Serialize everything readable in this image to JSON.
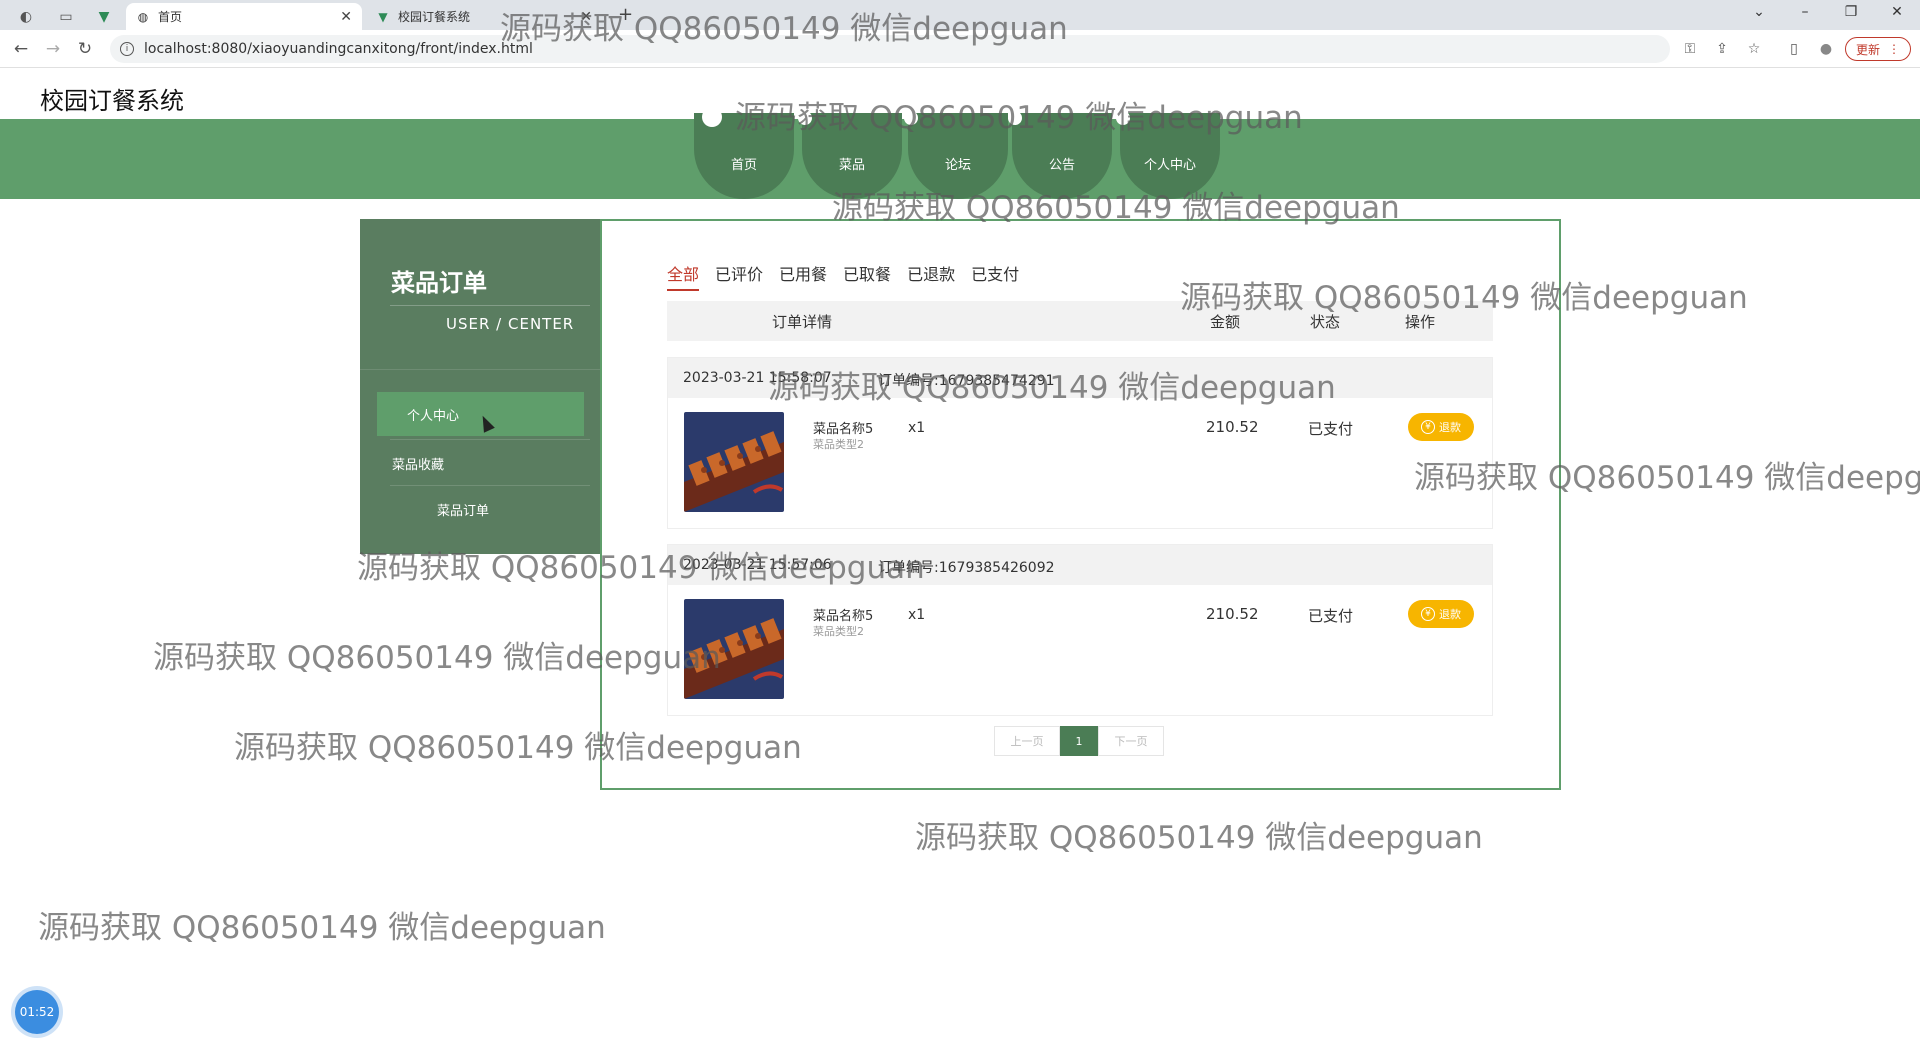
{
  "browser": {
    "tabs": [
      {
        "label": "首页",
        "active": true
      },
      {
        "label": "校园订餐系统",
        "active": false
      }
    ],
    "new_tab": "+",
    "url": "localhost:8080/xiaoyuandingcanxitong/front/index.html",
    "update_label": "更新",
    "window_controls": {
      "minimize": "–",
      "restore": "❐",
      "close": "✕",
      "dropdown": "⌄"
    }
  },
  "site": {
    "title": "校园订餐系统",
    "nav": [
      "首页",
      "菜品",
      "论坛",
      "公告",
      "个人中心"
    ]
  },
  "sidebar": {
    "title": "菜品订单",
    "subtitle": "USER / CENTER",
    "items": [
      {
        "label": "个人中心",
        "active": true
      },
      {
        "label": "菜品收藏",
        "active": false
      },
      {
        "label": "菜品订单",
        "active": false
      }
    ]
  },
  "orders_panel": {
    "tabs": [
      {
        "label": "全部",
        "active": true
      },
      {
        "label": "已评价",
        "active": false
      },
      {
        "label": "已用餐",
        "active": false
      },
      {
        "label": "已取餐",
        "active": false
      },
      {
        "label": "已退款",
        "active": false
      },
      {
        "label": "已支付",
        "active": false
      }
    ],
    "header": {
      "detail": "订单详情",
      "amount": "金额",
      "status": "状态",
      "action": "操作"
    },
    "orders": [
      {
        "time": "2023-03-21 15:58:07",
        "order_no_label": "订单编号:1679385474291",
        "item_name": "菜品名称5",
        "item_type": "菜品类型2",
        "quantity": "x1",
        "amount": "210.52",
        "status": "已支付",
        "action": "退款"
      },
      {
        "time": "2023-03-21 15:57:06",
        "order_no_label": "订单编号:1679385426092",
        "item_name": "菜品名称5",
        "item_type": "菜品类型2",
        "quantity": "x1",
        "amount": "210.52",
        "status": "已支付",
        "action": "退款"
      }
    ],
    "pager": {
      "prev": "上一页",
      "current": "1",
      "next": "下一页"
    }
  },
  "timer": "01:52",
  "watermark": "源码获取 QQ86050149 微信deepguan",
  "icons": {
    "back": "←",
    "forward": "→",
    "reload": "↻",
    "info": "i",
    "key": "⚿",
    "share": "⇪",
    "star": "☆",
    "sidebar_toggle": "▯",
    "profile": "●",
    "menu": "⋮",
    "yen": "¥"
  },
  "colors": {
    "nav_green": "#5f9e6b",
    "nav_dark": "#4b7d55",
    "sidebar": "#5a7d60",
    "accent_red": "#c0392b",
    "refund_yellow": "#f7b500"
  }
}
